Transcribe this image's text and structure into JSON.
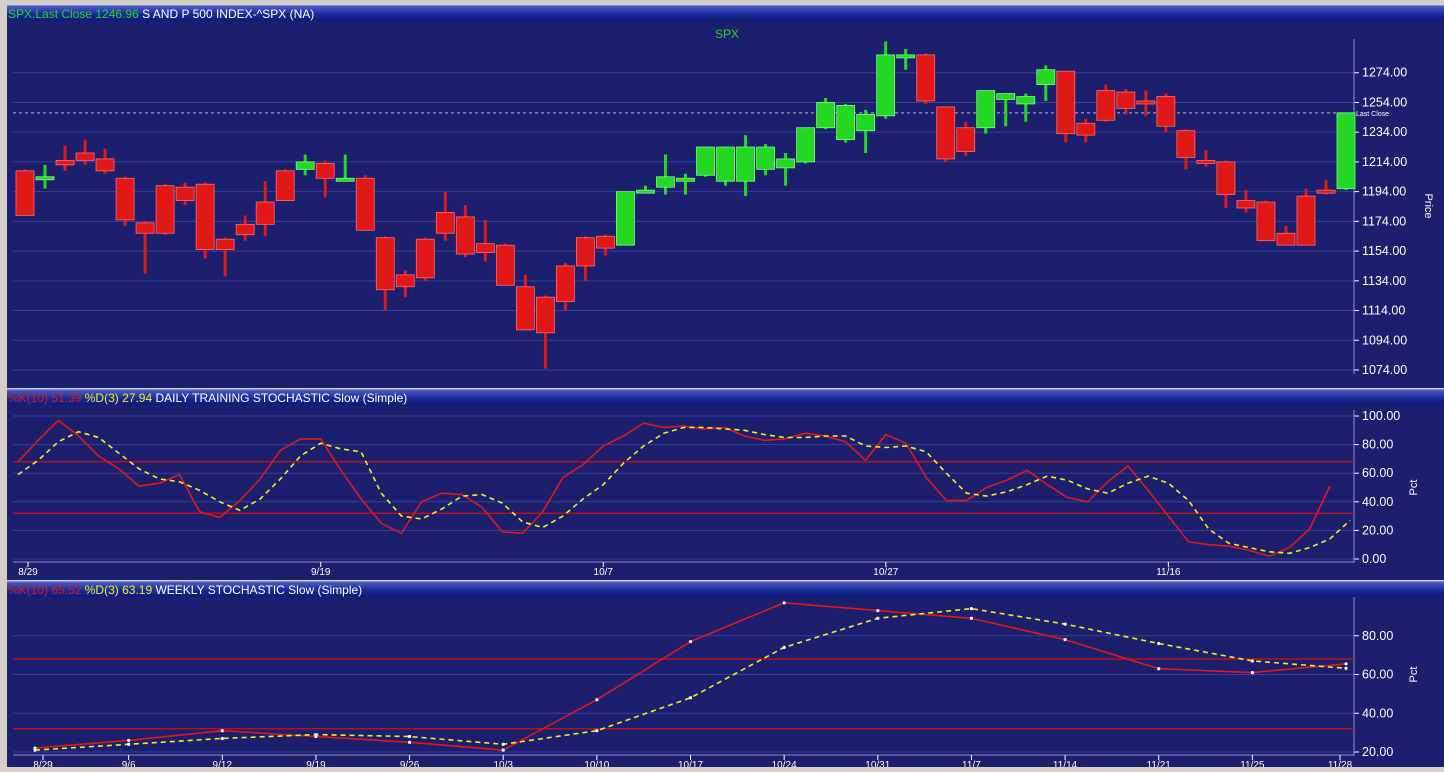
{
  "price_pane": {
    "header": {
      "symbol_label": "SPX.Last Close",
      "last_close": "1246.96",
      "title": "S AND P 500 INDEX-^SPX (NA)"
    },
    "panel_label": "SPX",
    "y_axis_title": "Price",
    "last_close_marker": "Last Close"
  },
  "daily_pane": {
    "header": {
      "k_label": "%K(10)",
      "k_value": "51.39",
      "d_label": "%D(3)",
      "d_value": "27.94",
      "title": "DAILY TRAINING STOCHASTIC Slow (Simple)"
    },
    "y_axis_title": "Pct"
  },
  "weekly_pane": {
    "header": {
      "k_label": "%K(10)",
      "k_value": "65.52",
      "d_label": "%D(3)",
      "d_value": "63.19",
      "title": "WEEKLY STOCHASTIC Slow (Simple)"
    },
    "y_axis_title": "Pct"
  },
  "colors": {
    "background": "#1b1f6e",
    "grid": "#3a3f96",
    "up_candle": "#22d822",
    "down_candle": "#e01818",
    "k_line": "#e01818",
    "d_line": "#f0f020",
    "band_line": "#cc1010",
    "axis_text": "#ffffff"
  },
  "chart_data": [
    {
      "type": "candlestick",
      "title": "SPX",
      "ylabel": "Price",
      "ylim": [
        1074,
        1294
      ],
      "yticks": [
        1074,
        1094,
        1114,
        1134,
        1154,
        1174,
        1194,
        1214,
        1234,
        1254,
        1274
      ],
      "reference_line": {
        "label": "Last Close",
        "value": 1246.96
      },
      "candles": [
        {
          "open": 1208,
          "high": 1209,
          "low": 1178,
          "close": 1178
        },
        {
          "open": 1204,
          "high": 1212,
          "low": 1196,
          "close": 1204
        },
        {
          "open": 1215,
          "high": 1225,
          "low": 1208,
          "close": 1212
        },
        {
          "open": 1220,
          "high": 1229,
          "low": 1212,
          "close": 1215
        },
        {
          "open": 1216,
          "high": 1223,
          "low": 1206,
          "close": 1208
        },
        {
          "open": 1203,
          "high": 1204,
          "low": 1171,
          "close": 1175
        },
        {
          "open": 1173,
          "high": 1174,
          "low": 1139,
          "close": 1166
        },
        {
          "open": 1198,
          "high": 1199,
          "low": 1165,
          "close": 1166
        },
        {
          "open": 1197,
          "high": 1200,
          "low": 1185,
          "close": 1188
        },
        {
          "open": 1199,
          "high": 1200,
          "low": 1149,
          "close": 1155
        },
        {
          "open": 1162,
          "high": 1163,
          "low": 1137,
          "close": 1155
        },
        {
          "open": 1172,
          "high": 1178,
          "low": 1161,
          "close": 1165
        },
        {
          "open": 1187,
          "high": 1201,
          "low": 1164,
          "close": 1172
        },
        {
          "open": 1208,
          "high": 1209,
          "low": 1188,
          "close": 1188
        },
        {
          "open": 1209,
          "high": 1219,
          "low": 1205,
          "close": 1214
        },
        {
          "open": 1213,
          "high": 1215,
          "low": 1190,
          "close": 1203
        },
        {
          "open": 1203,
          "high": 1219,
          "low": 1202,
          "close": 1203
        },
        {
          "open": 1203,
          "high": 1205,
          "low": 1168,
          "close": 1168
        },
        {
          "open": 1163,
          "high": 1164,
          "low": 1114,
          "close": 1128
        },
        {
          "open": 1138,
          "high": 1141,
          "low": 1123,
          "close": 1130
        },
        {
          "open": 1162,
          "high": 1163,
          "low": 1134,
          "close": 1136
        },
        {
          "open": 1180,
          "high": 1194,
          "low": 1161,
          "close": 1166
        },
        {
          "open": 1177,
          "high": 1185,
          "low": 1150,
          "close": 1152
        },
        {
          "open": 1159,
          "high": 1175,
          "low": 1147,
          "close": 1153
        },
        {
          "open": 1158,
          "high": 1159,
          "low": 1131,
          "close": 1131
        },
        {
          "open": 1130,
          "high": 1138,
          "low": 1101,
          "close": 1101
        },
        {
          "open": 1123,
          "high": 1124,
          "low": 1075,
          "close": 1099
        },
        {
          "open": 1144,
          "high": 1146,
          "low": 1114,
          "close": 1120
        },
        {
          "open": 1163,
          "high": 1164,
          "low": 1134,
          "close": 1144
        },
        {
          "open": 1164,
          "high": 1165,
          "low": 1151,
          "close": 1156
        },
        {
          "open": 1158,
          "high": 1194,
          "low": 1158,
          "close": 1194
        },
        {
          "open": 1194,
          "high": 1198,
          "low": 1193,
          "close": 1195
        },
        {
          "open": 1197,
          "high": 1219,
          "low": 1192,
          "close": 1204
        },
        {
          "open": 1203,
          "high": 1206,
          "low": 1192,
          "close": 1203
        },
        {
          "open": 1205,
          "high": 1224,
          "low": 1204,
          "close": 1224
        },
        {
          "open": 1201,
          "high": 1224,
          "low": 1198,
          "close": 1224
        },
        {
          "open": 1201,
          "high": 1232,
          "low": 1191,
          "close": 1224
        },
        {
          "open": 1209,
          "high": 1226,
          "low": 1205,
          "close": 1224
        },
        {
          "open": 1210,
          "high": 1220,
          "low": 1198,
          "close": 1216
        },
        {
          "open": 1214,
          "high": 1237,
          "low": 1213,
          "close": 1237
        },
        {
          "open": 1237,
          "high": 1257,
          "low": 1236,
          "close": 1254
        },
        {
          "open": 1229,
          "high": 1253,
          "low": 1227,
          "close": 1252
        },
        {
          "open": 1235,
          "high": 1249,
          "low": 1220,
          "close": 1246
        },
        {
          "open": 1245,
          "high": 1295,
          "low": 1243,
          "close": 1286
        },
        {
          "open": 1285,
          "high": 1290,
          "low": 1276,
          "close": 1286
        },
        {
          "open": 1286,
          "high": 1287,
          "low": 1253,
          "close": 1255
        },
        {
          "open": 1251,
          "high": 1251,
          "low": 1214,
          "close": 1216
        },
        {
          "open": 1237,
          "high": 1241,
          "low": 1218,
          "close": 1221
        },
        {
          "open": 1237,
          "high": 1262,
          "low": 1233,
          "close": 1262
        },
        {
          "open": 1256,
          "high": 1260,
          "low": 1238,
          "close": 1260
        },
        {
          "open": 1253,
          "high": 1260,
          "low": 1241,
          "close": 1258
        },
        {
          "open": 1266,
          "high": 1279,
          "low": 1255,
          "close": 1276
        },
        {
          "open": 1275,
          "high": 1275,
          "low": 1227,
          "close": 1233
        },
        {
          "open": 1240,
          "high": 1243,
          "low": 1227,
          "close": 1232
        },
        {
          "open": 1262,
          "high": 1266,
          "low": 1241,
          "close": 1242
        },
        {
          "open": 1261,
          "high": 1263,
          "low": 1246,
          "close": 1250
        },
        {
          "open": 1255,
          "high": 1262,
          "low": 1245,
          "close": 1253
        },
        {
          "open": 1258,
          "high": 1260,
          "low": 1234,
          "close": 1238
        },
        {
          "open": 1235,
          "high": 1236,
          "low": 1209,
          "close": 1217
        },
        {
          "open": 1215,
          "high": 1222,
          "low": 1211,
          "close": 1213
        },
        {
          "open": 1214,
          "high": 1215,
          "low": 1183,
          "close": 1192
        },
        {
          "open": 1188,
          "high": 1195,
          "low": 1180,
          "close": 1183
        },
        {
          "open": 1187,
          "high": 1188,
          "low": 1161,
          "close": 1161
        },
        {
          "open": 1166,
          "high": 1171,
          "low": 1158,
          "close": 1158
        },
        {
          "open": 1191,
          "high": 1196,
          "low": 1158,
          "close": 1158
        },
        {
          "open": 1195,
          "high": 1202,
          "low": 1192,
          "close": 1194
        },
        {
          "open": 1196,
          "high": 1247,
          "low": 1195,
          "close": 1247
        }
      ]
    },
    {
      "type": "line",
      "title": "DAILY TRAINING STOCHASTIC Slow (Simple)",
      "ylabel": "Pct",
      "ylim": [
        0,
        100
      ],
      "yticks": [
        0,
        20,
        40,
        60,
        80,
        100
      ],
      "bands": [
        32,
        68
      ],
      "x_tick_labels": [
        {
          "label": "8/29",
          "index": 0
        },
        {
          "label": "9/19",
          "index": 15
        },
        {
          "label": "10/7",
          "index": 29
        },
        {
          "label": "10/27",
          "index": 43
        },
        {
          "label": "11/16",
          "index": 57
        }
      ],
      "series": [
        {
          "name": "%K(10)",
          "style": "solid",
          "color": "#e01818",
          "values": [
            68,
            83,
            97,
            86,
            72,
            63,
            51,
            53,
            59,
            33,
            29,
            41,
            56,
            76,
            84,
            84,
            62,
            42,
            25,
            18,
            40,
            46,
            45,
            36,
            19,
            18,
            33,
            57,
            66,
            79,
            86,
            95,
            92,
            93,
            91,
            92,
            86,
            83,
            84,
            88,
            86,
            82,
            69,
            87,
            81,
            57,
            41,
            41,
            50,
            55,
            62,
            52,
            43,
            40,
            54,
            65,
            48,
            30,
            12,
            10,
            9,
            6,
            2,
            8,
            21,
            51
          ]
        },
        {
          "name": "%D(3)",
          "style": "dashed",
          "color": "#f0f020",
          "values": [
            59,
            69,
            82,
            89,
            85,
            74,
            63,
            56,
            54,
            48,
            40,
            34,
            42,
            56,
            72,
            81,
            77,
            75,
            46,
            30,
            28,
            35,
            44,
            45,
            39,
            26,
            22,
            30,
            42,
            52,
            67,
            79,
            88,
            92,
            92,
            91,
            90,
            87,
            85,
            85,
            86,
            86,
            79,
            78,
            79,
            75,
            60,
            46,
            44,
            47,
            52,
            58,
            55,
            49,
            46,
            53,
            58,
            53,
            41,
            21,
            11,
            8,
            5,
            4,
            8,
            14,
            27
          ]
        }
      ]
    },
    {
      "type": "line",
      "title": "WEEKLY STOCHASTIC Slow (Simple)",
      "ylabel": "Pct",
      "ylim": [
        20,
        100
      ],
      "yticks": [
        20,
        40,
        60,
        80
      ],
      "bands": [
        32,
        68
      ],
      "categories": [
        "8/29",
        "9/6",
        "9/12",
        "9/19",
        "9/26",
        "10/3",
        "10/10",
        "10/17",
        "10/24",
        "10/31",
        "11/7",
        "11/14",
        "11/21",
        "11/25",
        "11/28"
      ],
      "series": [
        {
          "name": "%K(10)",
          "style": "solid",
          "color": "#e01818",
          "values": [
            22,
            26,
            31,
            28,
            25,
            21,
            47,
            77,
            97,
            93,
            89,
            78,
            63,
            61,
            65.52
          ]
        },
        {
          "name": "%D(3)",
          "style": "dashed",
          "color": "#f0f020",
          "values": [
            21,
            24,
            27,
            29,
            28,
            24,
            31,
            48,
            74,
            89,
            94,
            86,
            76,
            67,
            63.19
          ]
        }
      ]
    }
  ]
}
